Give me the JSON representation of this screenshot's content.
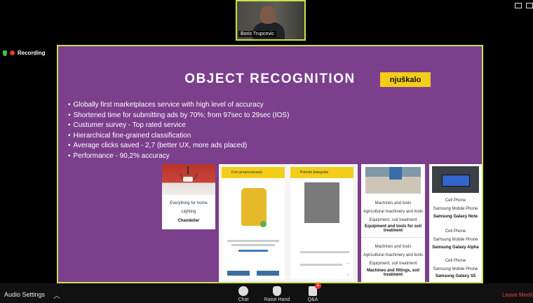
{
  "meeting": {
    "participant_name": "Boris Trupcevic",
    "recording_label": "Recording"
  },
  "slide": {
    "title": "OBJECT RECOGNITION",
    "logo_text": "njuškalo",
    "bullets": [
      "Globally first marketplaces service with high level of accuracy",
      "Shortened time for submitting ads by 70%; from 97sec to 29sec (IOS)",
      "Custumer survey - Top rated service",
      "Hierarchical fine-grained classification",
      "Average clicks saved - 2,7 (better UX, more ads placed)",
      "Performance - 90,2% accuracy"
    ],
    "card_home": {
      "labels": [
        "Everything for home",
        "Lighting"
      ],
      "result": "Chandelier"
    },
    "card_phone": {
      "left_title": "Foto prepoznavanje",
      "right_title": "Potvrde kategorije"
    },
    "card_machines": {
      "group1": [
        "Machines and tools",
        "Agricultural machinery and tools",
        "Equipment, soil treatment"
      ],
      "result1": "Equipment and tools for soil treatment",
      "group2": [
        "Machines and tools",
        "Agricultural machinery and tools",
        "Equipment, soil treatment"
      ],
      "result2": "Machines and fittings, soil treatment"
    },
    "card_samsung": {
      "group1": [
        "Cell Phone",
        "Samsung Mobile Phone"
      ],
      "result1": "Samsung Galaxy Note",
      "group2": [
        "Cell Phone",
        "Samsung Mobile Phone"
      ],
      "result2": "Samsung Galaxy Alpha",
      "group3": [
        "Cell Phone",
        "Samsung Mobile Phone"
      ],
      "result3": "Samsung Galaxy S5"
    }
  },
  "toolbar": {
    "audio_settings": "Audio Settings",
    "chat": "Chat",
    "raise_hand": "Raise Hand",
    "qa": "Q&A",
    "qa_badge": "1",
    "leave": "Leave Meeting"
  },
  "colors": {
    "slide_bg": "#7c3f8c",
    "accent_border": "#c9e24a",
    "logo_bg": "#f2cd1a",
    "recording_red": "#e23b2e",
    "leave_red": "#e0453a"
  }
}
